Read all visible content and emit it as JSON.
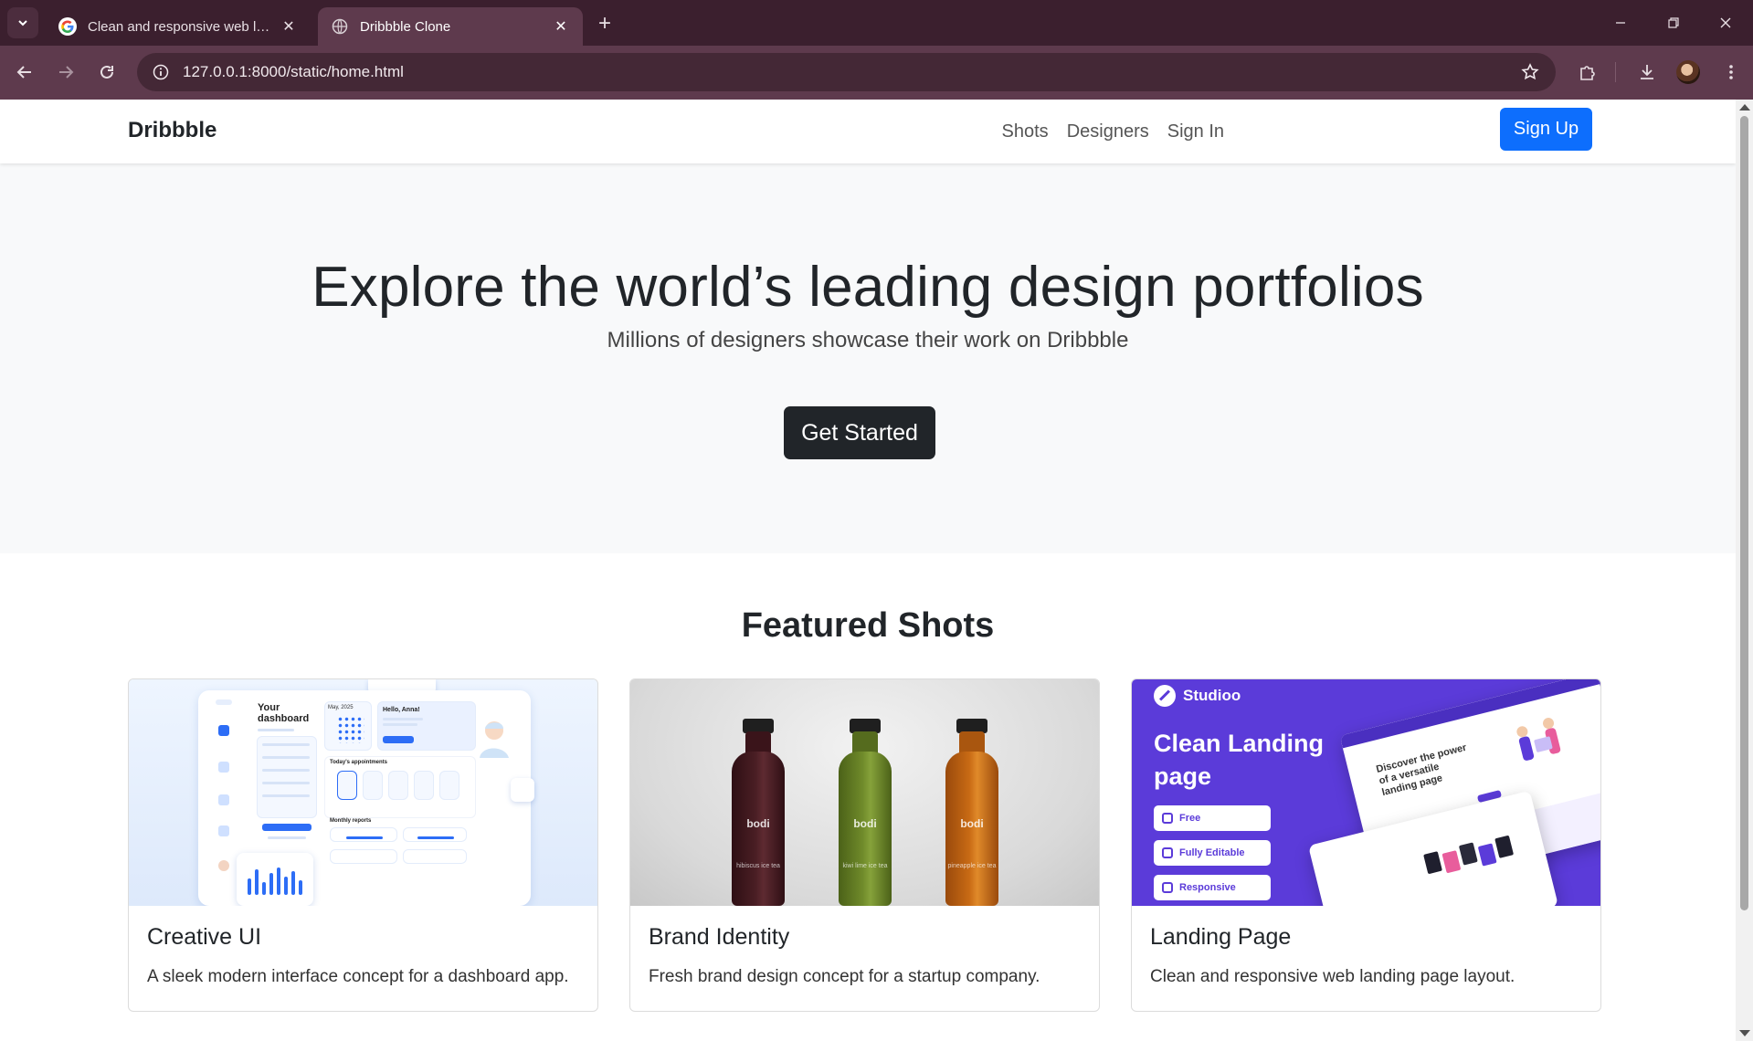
{
  "browser": {
    "tabs": [
      {
        "title": "Clean and responsive web landi",
        "active": false,
        "favicon": "google-g-icon"
      },
      {
        "title": "Dribbble Clone",
        "active": true,
        "favicon": "globe-icon"
      }
    ],
    "url": "127.0.0.1:8000/static/home.html"
  },
  "navbar": {
    "brand": "Dribbble",
    "links": [
      "Shots",
      "Designers",
      "Sign In"
    ],
    "signup_label": "Sign Up"
  },
  "hero": {
    "title": "Explore the world’s leading design portfolios",
    "subtitle": "Millions of designers showcase their work on Dribbble",
    "cta_label": "Get Started"
  },
  "featured": {
    "title": "Featured Shots",
    "cards": [
      {
        "title": "Creative UI",
        "description": "A sleek modern interface concept for a dashboard app."
      },
      {
        "title": "Brand Identity",
        "description": "Fresh brand design concept for a startup company."
      },
      {
        "title": "Landing Page",
        "description": "Clean and responsive web landing page layout."
      }
    ]
  },
  "thumbs": {
    "dashboard": {
      "heading_line1": "Your",
      "heading_line2": "dashboard",
      "greeting": "Hello, Anna!",
      "date": "May, 2025",
      "appointments": "Today's appointments",
      "reports": "Monthly reports"
    },
    "bottles": {
      "brand": "bodi",
      "flavors": [
        "hibiscus ice tea",
        "kiwi lime ice tea",
        "pineapple ice tea"
      ],
      "colors": [
        "#4a1e24",
        "#6f8a2a",
        "#c86a14"
      ]
    },
    "landing": {
      "logo": "Studioo",
      "headline_line1": "Clean Landing",
      "headline_line2": "page",
      "pills": [
        "Free",
        "Fully Editable",
        "Responsive"
      ],
      "mock_text_line1": "Discover the power",
      "mock_text_line2": "of a versatile",
      "mock_text_line3": "landing page"
    }
  },
  "colors": {
    "primary": "#0d6efd",
    "dark": "#212529",
    "chrome_frame": "#3b1f2e",
    "chrome_toolbar": "#5e3a4d",
    "landing_purple": "#5b3bd9"
  }
}
